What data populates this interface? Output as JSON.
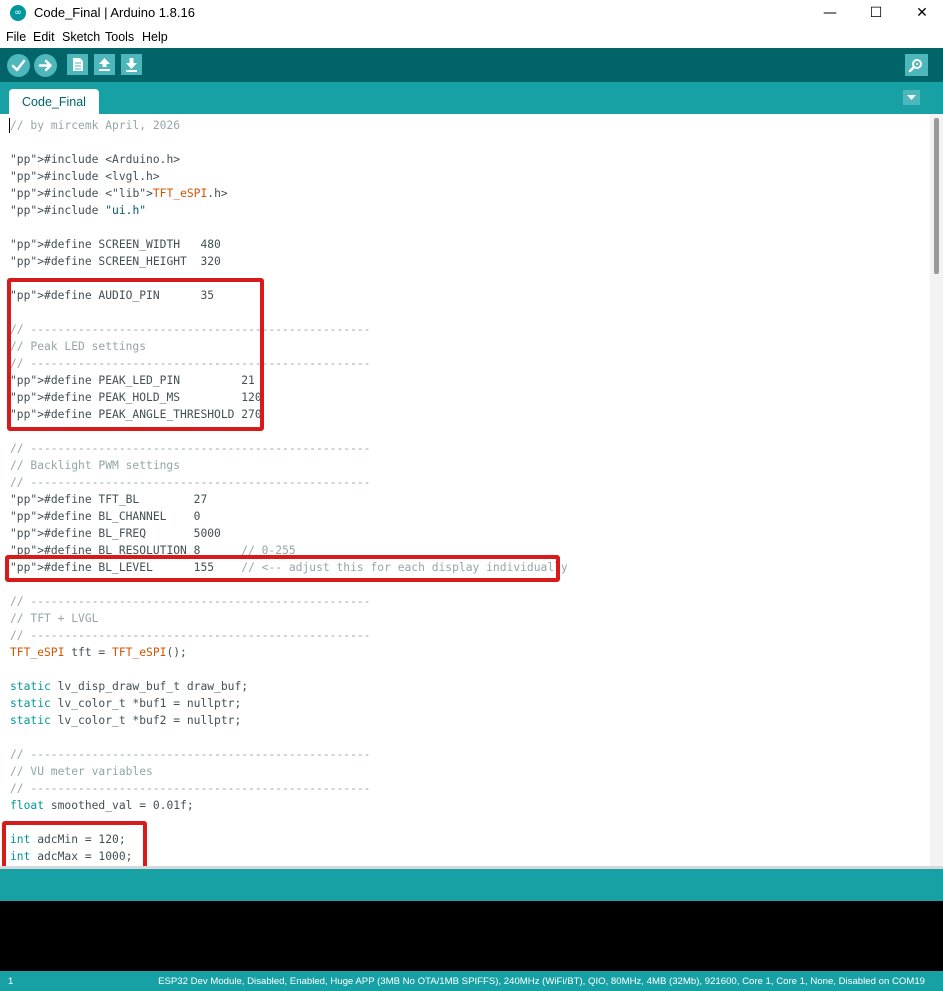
{
  "window": {
    "title": "Code_Final | Arduino 1.8.16",
    "app_icon": "arduino-logo-icon",
    "minimize_icon": "minimize-icon",
    "maximize_icon": "maximize-icon",
    "close_icon": "close-icon"
  },
  "menu": [
    "File",
    "Edit",
    "Sketch",
    "Tools",
    "Help"
  ],
  "toolbar": {
    "buttons": [
      "verify-icon",
      "upload-icon",
      "new-icon",
      "open-icon",
      "save-icon"
    ],
    "serial_monitor": "serial-monitor-icon"
  },
  "tabs": [
    {
      "label": "Code_Final"
    }
  ],
  "code_lines": [
    "// by mircemk April, 2026",
    "",
    "#include <Arduino.h>",
    "#include <lvgl.h>",
    "#include <TFT_eSPI.h>",
    "#include \"ui.h\"",
    "",
    "#define SCREEN_WIDTH   480",
    "#define SCREEN_HEIGHT  320",
    "",
    "#define AUDIO_PIN      35",
    "",
    "// --------------------------------------------------",
    "// Peak LED settings",
    "// --------------------------------------------------",
    "#define PEAK_LED_PIN         21",
    "#define PEAK_HOLD_MS         120",
    "#define PEAK_ANGLE_THRESHOLD 270",
    "",
    "// --------------------------------------------------",
    "// Backlight PWM settings",
    "// --------------------------------------------------",
    "#define TFT_BL        27",
    "#define BL_CHANNEL    0",
    "#define BL_FREQ       5000",
    "#define BL_RESOLUTION 8      // 0-255",
    "#define BL_LEVEL      155    // <-- adjust this for each display individually",
    "",
    "// --------------------------------------------------",
    "// TFT + LVGL",
    "// --------------------------------------------------",
    "TFT_eSPI tft = TFT_eSPI();",
    "",
    "static lv_disp_draw_buf_t draw_buf;",
    "static lv_color_t *buf1 = nullptr;",
    "static lv_color_t *buf2 = nullptr;",
    "",
    "// --------------------------------------------------",
    "// VU meter variables",
    "// --------------------------------------------------",
    "float smoothed_val = 0.01f;",
    "",
    "int adcMin = 120;",
    "int adcMax = 1000;"
  ],
  "status": {
    "line_number": "1",
    "board": "ESP32 Dev Module, Disabled, Enabled, Huge APP (3MB No OTA/1MB SPIFFS), 240MHz (WiFi/BT), QIO, 80MHz, 4MB (32Mb), 921600, Core 1, Core 1, None, Disabled on COM19"
  },
  "colors": {
    "toolbar": "#006468",
    "tabbar": "#17a1a5",
    "highlight_box": "#d91a1a",
    "comment": "#95a5a6",
    "preprocessor": "#5e6d03",
    "library": "#d35400",
    "keyword": "#00979c"
  }
}
